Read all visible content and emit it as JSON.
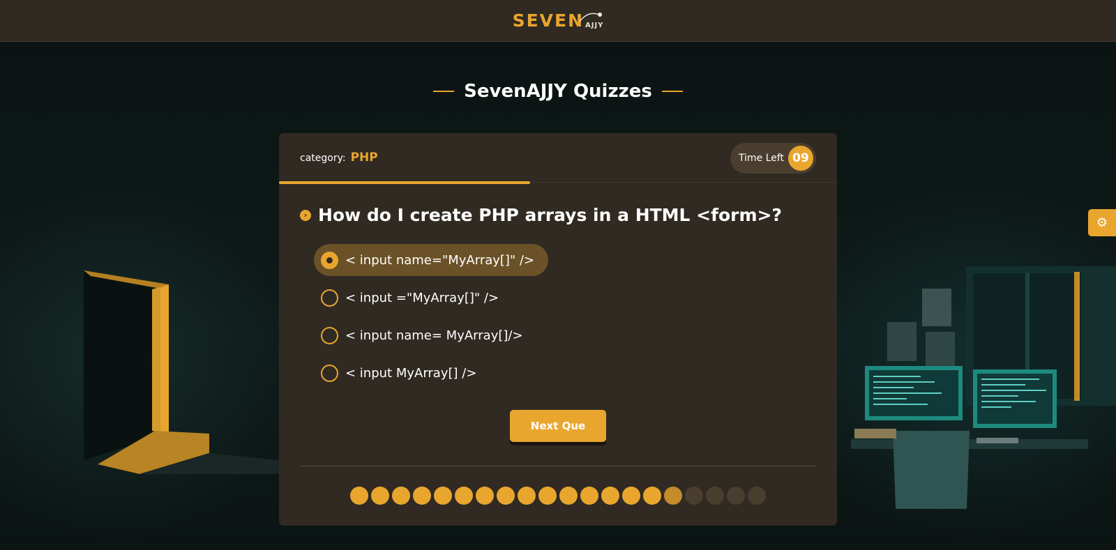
{
  "header": {
    "logo_main": "SEVEN",
    "logo_sub": "AJJY"
  },
  "page": {
    "title": "SevenAJJY Quizzes"
  },
  "quiz": {
    "category_label": "category:",
    "category_value": "PHP",
    "timer_label": "Time Left",
    "timer_value": "09",
    "progress_fraction": 0.45,
    "question": "How do I create PHP arrays in a HTML <form>?",
    "answers": [
      {
        "text": "< input name=\"MyArray[]\" />",
        "selected": true
      },
      {
        "text": "< input =\"MyArray[]\" />",
        "selected": false
      },
      {
        "text": "< input name= MyArray[]/>",
        "selected": false
      },
      {
        "text": "< input MyArray[] />",
        "selected": false
      }
    ],
    "next_label": "Next Que",
    "total_questions": 20,
    "answered_count": 15,
    "current_index": 16
  },
  "icons": {
    "settings": "gear-icon",
    "question_marker": "chevron-right-icon"
  },
  "colors": {
    "accent": "#e9a62e",
    "card": "#302a23",
    "background": "#0c1514"
  }
}
